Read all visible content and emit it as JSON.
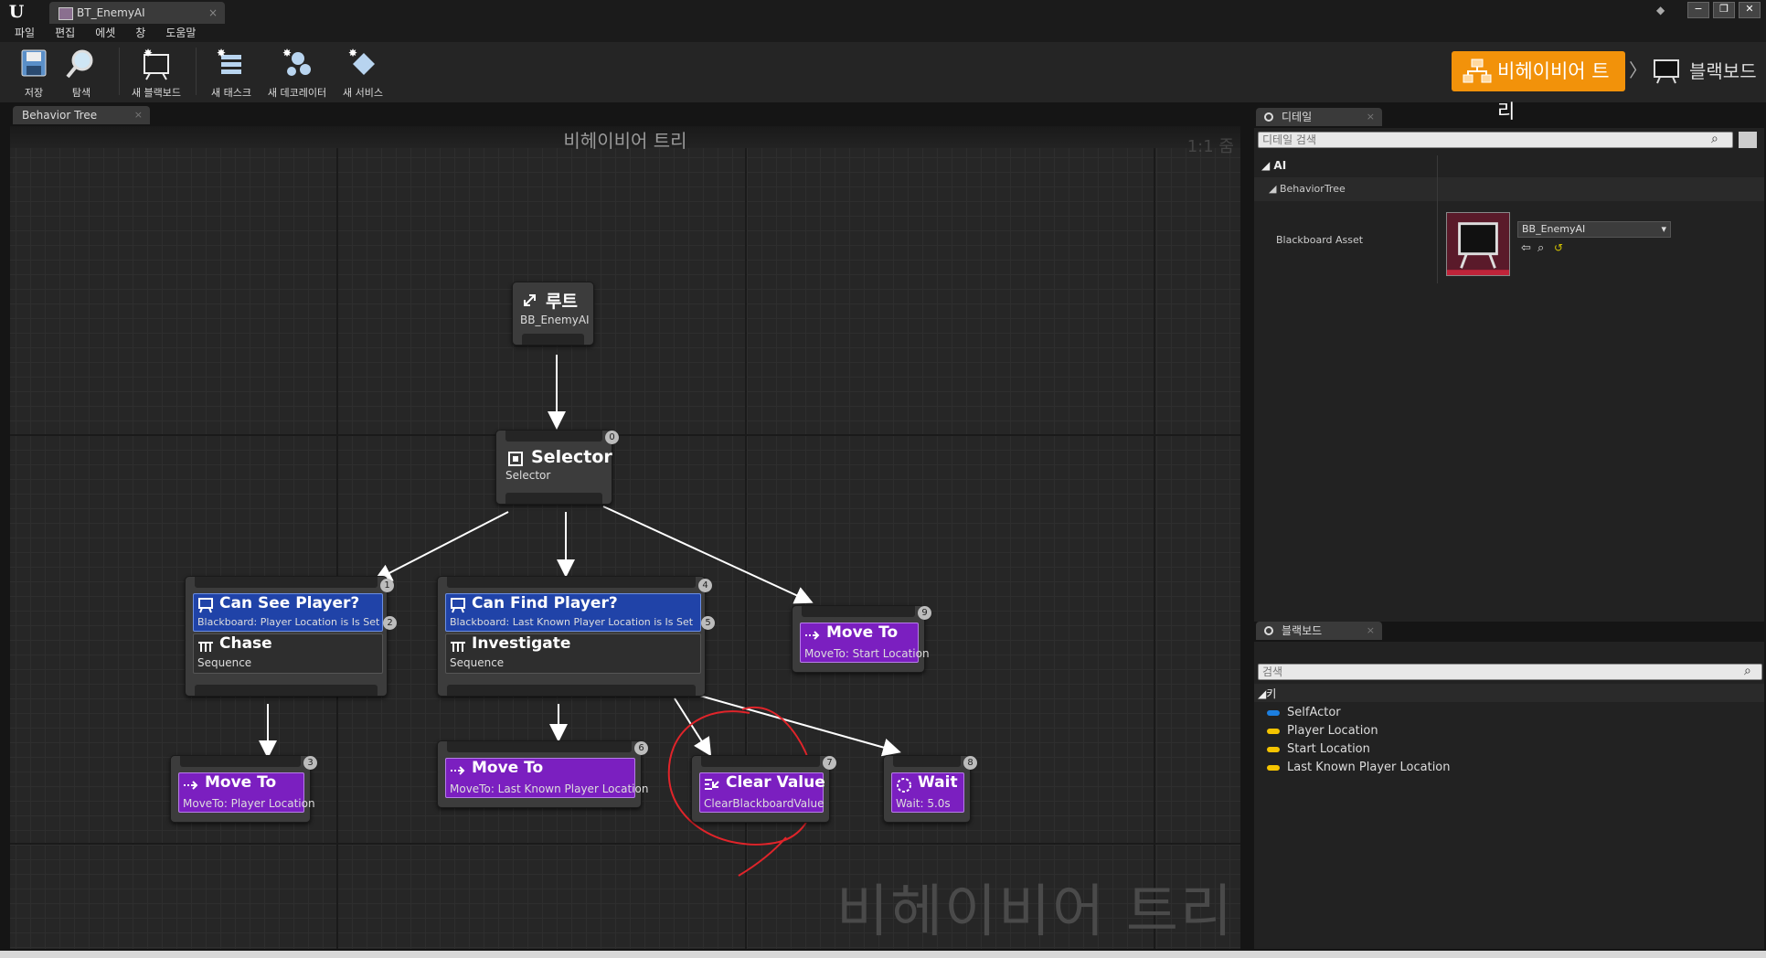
{
  "window": {
    "tab_title": "BT_EnemyAI",
    "tab_close": "×",
    "controls": [
      "−",
      "❐",
      "✕"
    ]
  },
  "menu": [
    "파일",
    "편집",
    "에셋",
    "창",
    "도움말"
  ],
  "toolbar": {
    "save": "저장",
    "browse": "탐색",
    "new_blackboard": "새 블랙보드",
    "new_task": "새 태스크",
    "new_decorator": "새 데코레이터",
    "new_service": "새 서비스"
  },
  "modes": {
    "behavior_tree": "비헤이비어 트리",
    "separator": "〉",
    "blackboard": "블랙보드"
  },
  "graph": {
    "tab_label": "Behavior Tree",
    "tab_close": "×",
    "title": "비헤이비어 트리",
    "zoom": "1:1 줌",
    "watermark": "비헤이비어 트리",
    "nodes": {
      "root": {
        "title": "루트",
        "sub": "BB_EnemyAI"
      },
      "selector": {
        "title": "Selector",
        "sub": "Selector",
        "order": "0"
      },
      "chase": {
        "decorator_title": "Can See Player?",
        "decorator_sub": "Blackboard: Player Location is Is Set",
        "decorator_order": "2",
        "title": "Chase",
        "sub": "Sequence",
        "order": "1"
      },
      "investigate": {
        "decorator_title": "Can Find Player?",
        "decorator_sub": "Blackboard: Last Known Player Location is Is Set",
        "decorator_order": "5",
        "title": "Investigate",
        "sub": "Sequence",
        "order": "4"
      },
      "moveto_start": {
        "title": "Move To",
        "sub": "MoveTo: Start Location",
        "order": "9"
      },
      "moveto_player": {
        "title": "Move To",
        "sub": "MoveTo: Player Location",
        "order": "3"
      },
      "moveto_lastknown": {
        "title": "Move To",
        "sub": "MoveTo: Last Known Player Location",
        "order": "6"
      },
      "clear_value": {
        "title": "Clear Value",
        "sub": "ClearBlackboardValue",
        "order": "7"
      },
      "wait": {
        "title": "Wait",
        "sub": "Wait: 5.0s",
        "order": "8"
      }
    }
  },
  "details": {
    "tab_label": "디테일",
    "tab_close": "×",
    "search_placeholder": "디테일 검색",
    "section_ai": "AI",
    "section_bt": "BehaviorTree",
    "prop_label": "Blackboard Asset",
    "prop_value": "BB_EnemyAI"
  },
  "blackboard": {
    "tab_label": "블랙보드",
    "tab_close": "×",
    "search_placeholder": "검색",
    "keys_header": "키",
    "keys": [
      {
        "name": "SelfActor",
        "color": "#1c7fe0"
      },
      {
        "name": "Player Location",
        "color": "#f5c400"
      },
      {
        "name": "Start Location",
        "color": "#f5c400"
      },
      {
        "name": "Last Known Player Location",
        "color": "#f5c400"
      }
    ]
  },
  "colors": {
    "accent": "#f2920a",
    "decorator": "#2043a8",
    "task": "#7b1fc0",
    "annotation": "#e0242a"
  }
}
